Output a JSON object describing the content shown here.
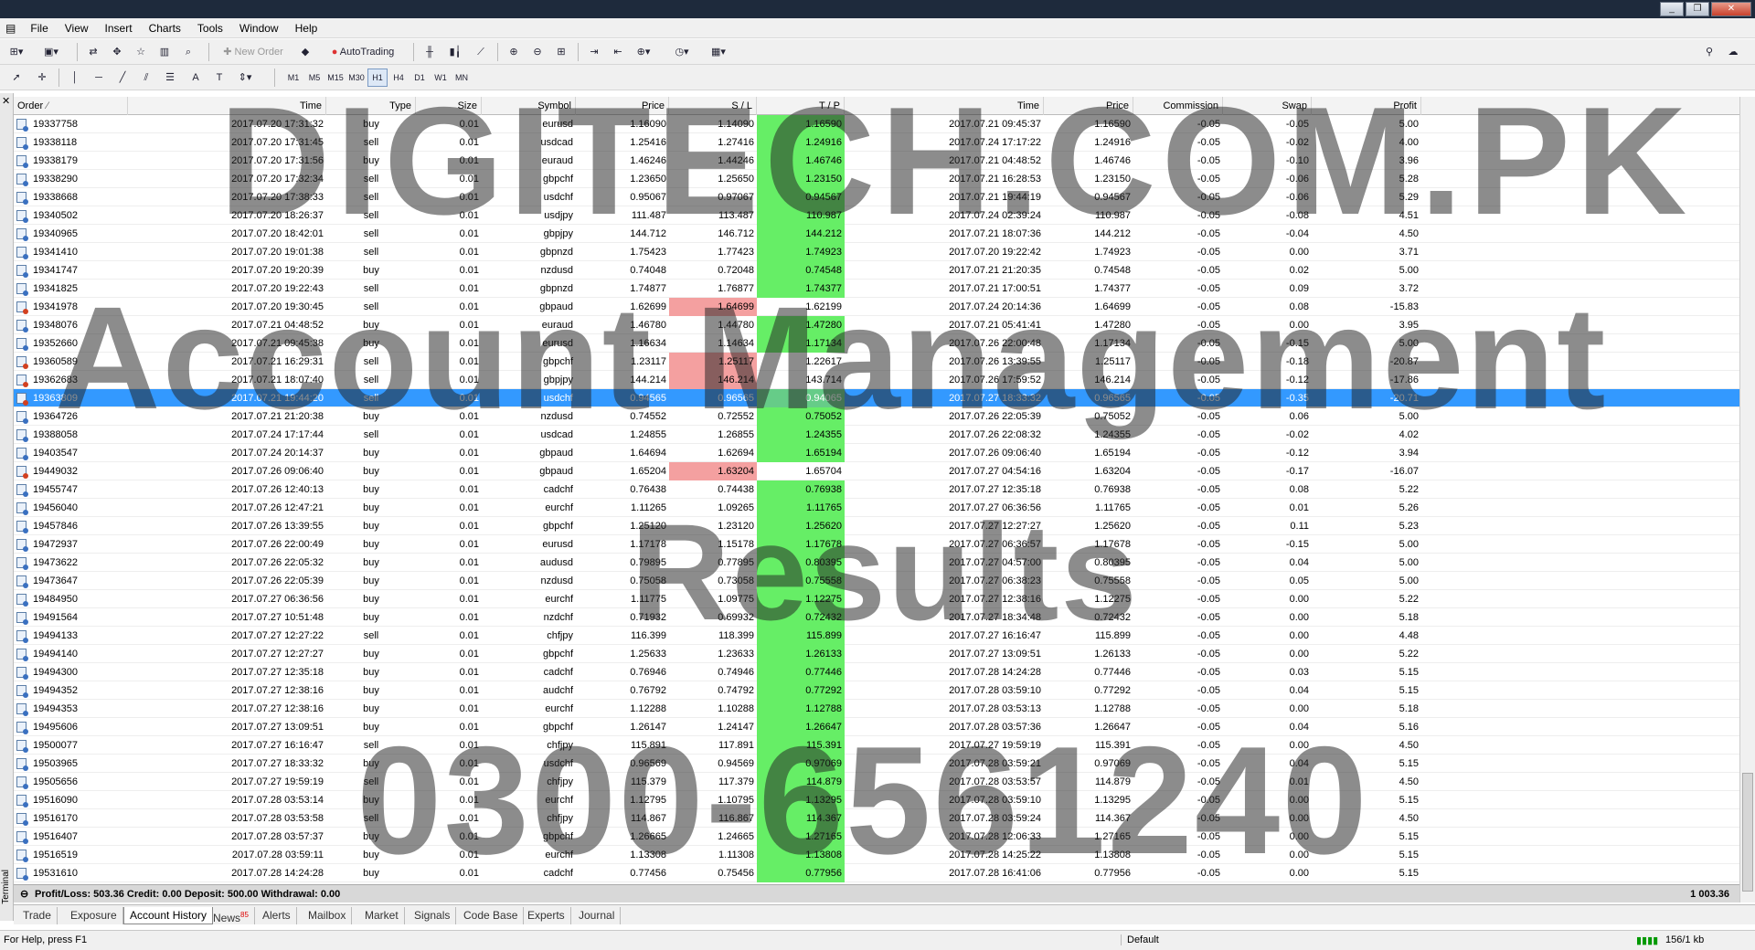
{
  "window": {
    "controls": [
      "_",
      "❐",
      "✕"
    ],
    "mdi_controls": [
      "_",
      "❐",
      "✕"
    ]
  },
  "menu": [
    "File",
    "View",
    "Insert",
    "Charts",
    "Tools",
    "Window",
    "Help"
  ],
  "toolbar": {
    "new_order": "New Order",
    "autotrading": "AutoTrading",
    "timeframes": [
      "M1",
      "M5",
      "M15",
      "M30",
      "H1",
      "H4",
      "D1",
      "W1",
      "MN"
    ],
    "active_timeframe": "H1"
  },
  "columns": [
    "Order",
    "Time",
    "Type",
    "Size",
    "Symbol",
    "Price",
    "S / L",
    "T / P",
    "Time",
    "Price",
    "Commission",
    "Swap",
    "Profit"
  ],
  "rows": [
    [
      "19337758",
      "2017.07.20 17:31:32",
      "buy",
      "0.01",
      "eurusd",
      "1.16090",
      "1.14090",
      "1.16590",
      "2017.07.21 09:45:37",
      "1.16590",
      "-0.05",
      "-0.05",
      "5.00"
    ],
    [
      "19338118",
      "2017.07.20 17:31:45",
      "sell",
      "0.01",
      "usdcad",
      "1.25416",
      "1.27416",
      "1.24916",
      "2017.07.24 17:17:22",
      "1.24916",
      "-0.05",
      "-0.02",
      "4.00"
    ],
    [
      "19338179",
      "2017.07.20 17:31:56",
      "buy",
      "0.01",
      "euraud",
      "1.46246",
      "1.44246",
      "1.46746",
      "2017.07.21 04:48:52",
      "1.46746",
      "-0.05",
      "-0.10",
      "3.96"
    ],
    [
      "19338290",
      "2017.07.20 17:32:34",
      "sell",
      "0.01",
      "gbpchf",
      "1.23650",
      "1.25650",
      "1.23150",
      "2017.07.21 16:28:53",
      "1.23150",
      "-0.05",
      "-0.06",
      "5.28"
    ],
    [
      "19338668",
      "2017.07.20 17:38:33",
      "sell",
      "0.01",
      "usdchf",
      "0.95067",
      "0.97067",
      "0.94567",
      "2017.07.21 19:44:19",
      "0.94567",
      "-0.05",
      "-0.06",
      "5.29"
    ],
    [
      "19340502",
      "2017.07.20 18:26:37",
      "sell",
      "0.01",
      "usdjpy",
      "111.487",
      "113.487",
      "110.987",
      "2017.07.24 02:39:24",
      "110.987",
      "-0.05",
      "-0.08",
      "4.51"
    ],
    [
      "19340965",
      "2017.07.20 18:42:01",
      "sell",
      "0.01",
      "gbpjpy",
      "144.712",
      "146.712",
      "144.212",
      "2017.07.21 18:07:36",
      "144.212",
      "-0.05",
      "-0.04",
      "4.50"
    ],
    [
      "19341410",
      "2017.07.20 19:01:38",
      "sell",
      "0.01",
      "gbpnzd",
      "1.75423",
      "1.77423",
      "1.74923",
      "2017.07.20 19:22:42",
      "1.74923",
      "-0.05",
      "0.00",
      "3.71"
    ],
    [
      "19341747",
      "2017.07.20 19:20:39",
      "buy",
      "0.01",
      "nzdusd",
      "0.74048",
      "0.72048",
      "0.74548",
      "2017.07.21 21:20:35",
      "0.74548",
      "-0.05",
      "0.02",
      "5.00"
    ],
    [
      "19341825",
      "2017.07.20 19:22:43",
      "sell",
      "0.01",
      "gbpnzd",
      "1.74877",
      "1.76877",
      "1.74377",
      "2017.07.21 17:00:51",
      "1.74377",
      "-0.05",
      "0.09",
      "3.72"
    ],
    [
      "19341978",
      "2017.07.20 19:30:45",
      "sell",
      "0.01",
      "gbpaud",
      "1.62699",
      "1.64699",
      "1.62199",
      "2017.07.24 20:14:36",
      "1.64699",
      "-0.05",
      "0.08",
      "-15.83"
    ],
    [
      "19348076",
      "2017.07.21 04:48:52",
      "buy",
      "0.01",
      "euraud",
      "1.46780",
      "1.44780",
      "1.47280",
      "2017.07.21 05:41:41",
      "1.47280",
      "-0.05",
      "0.00",
      "3.95"
    ],
    [
      "19352660",
      "2017.07.21 09:45:38",
      "buy",
      "0.01",
      "eurusd",
      "1.16634",
      "1.14634",
      "1.17134",
      "2017.07.26 22:00:48",
      "1.17134",
      "-0.05",
      "-0.15",
      "5.00"
    ],
    [
      "19360589",
      "2017.07.21 16:29:31",
      "sell",
      "0.01",
      "gbpchf",
      "1.23117",
      "1.25117",
      "1.22617",
      "2017.07.26 13:39:55",
      "1.25117",
      "-0.05",
      "-0.18",
      "-20.87"
    ],
    [
      "19362683",
      "2017.07.21 18:07:40",
      "sell",
      "0.01",
      "gbpjpy",
      "144.214",
      "146.214",
      "143.714",
      "2017.07.26 17:59:52",
      "146.214",
      "-0.05",
      "-0.12",
      "-17.86"
    ],
    [
      "19363809",
      "2017.07.21 19:44:20",
      "sell",
      "0.01",
      "usdchf",
      "0.94565",
      "0.96565",
      "0.94065",
      "2017.07.27 18:33:32",
      "0.96565",
      "-0.05",
      "-0.35",
      "-20.71"
    ],
    [
      "19364726",
      "2017.07.21 21:20:38",
      "buy",
      "0.01",
      "nzdusd",
      "0.74552",
      "0.72552",
      "0.75052",
      "2017.07.26 22:05:39",
      "0.75052",
      "-0.05",
      "0.06",
      "5.00"
    ],
    [
      "19388058",
      "2017.07.24 17:17:44",
      "sell",
      "0.01",
      "usdcad",
      "1.24855",
      "1.26855",
      "1.24355",
      "2017.07.26 22:08:32",
      "1.24355",
      "-0.05",
      "-0.02",
      "4.02"
    ],
    [
      "19403547",
      "2017.07.24 20:14:37",
      "buy",
      "0.01",
      "gbpaud",
      "1.64694",
      "1.62694",
      "1.65194",
      "2017.07.26 09:06:40",
      "1.65194",
      "-0.05",
      "-0.12",
      "3.94"
    ],
    [
      "19449032",
      "2017.07.26 09:06:40",
      "buy",
      "0.01",
      "gbpaud",
      "1.65204",
      "1.63204",
      "1.65704",
      "2017.07.27 04:54:16",
      "1.63204",
      "-0.05",
      "-0.17",
      "-16.07"
    ],
    [
      "19455747",
      "2017.07.26 12:40:13",
      "buy",
      "0.01",
      "cadchf",
      "0.76438",
      "0.74438",
      "0.76938",
      "2017.07.27 12:35:18",
      "0.76938",
      "-0.05",
      "0.08",
      "5.22"
    ],
    [
      "19456040",
      "2017.07.26 12:47:21",
      "buy",
      "0.01",
      "eurchf",
      "1.11265",
      "1.09265",
      "1.11765",
      "2017.07.27 06:36:56",
      "1.11765",
      "-0.05",
      "0.01",
      "5.26"
    ],
    [
      "19457846",
      "2017.07.26 13:39:55",
      "buy",
      "0.01",
      "gbpchf",
      "1.25120",
      "1.23120",
      "1.25620",
      "2017.07.27 12:27:27",
      "1.25620",
      "-0.05",
      "0.11",
      "5.23"
    ],
    [
      "19472937",
      "2017.07.26 22:00:49",
      "buy",
      "0.01",
      "eurusd",
      "1.17178",
      "1.15178",
      "1.17678",
      "2017.07.27 06:36:57",
      "1.17678",
      "-0.05",
      "-0.15",
      "5.00"
    ],
    [
      "19473622",
      "2017.07.26 22:05:32",
      "buy",
      "0.01",
      "audusd",
      "0.79895",
      "0.77895",
      "0.80395",
      "2017.07.27 04:57:00",
      "0.80395",
      "-0.05",
      "0.04",
      "5.00"
    ],
    [
      "19473647",
      "2017.07.26 22:05:39",
      "buy",
      "0.01",
      "nzdusd",
      "0.75058",
      "0.73058",
      "0.75558",
      "2017.07.27 06:38:23",
      "0.75558",
      "-0.05",
      "0.05",
      "5.00"
    ],
    [
      "19484950",
      "2017.07.27 06:36:56",
      "buy",
      "0.01",
      "eurchf",
      "1.11775",
      "1.09775",
      "1.12275",
      "2017.07.27 12:38:16",
      "1.12275",
      "-0.05",
      "0.00",
      "5.22"
    ],
    [
      "19491564",
      "2017.07.27 10:51:48",
      "buy",
      "0.01",
      "nzdchf",
      "0.71932",
      "0.69932",
      "0.72432",
      "2017.07.27 18:34:48",
      "0.72432",
      "-0.05",
      "0.00",
      "5.18"
    ],
    [
      "19494133",
      "2017.07.27 12:27:22",
      "sell",
      "0.01",
      "chfjpy",
      "116.399",
      "118.399",
      "115.899",
      "2017.07.27 16:16:47",
      "115.899",
      "-0.05",
      "0.00",
      "4.48"
    ],
    [
      "19494140",
      "2017.07.27 12:27:27",
      "buy",
      "0.01",
      "gbpchf",
      "1.25633",
      "1.23633",
      "1.26133",
      "2017.07.27 13:09:51",
      "1.26133",
      "-0.05",
      "0.00",
      "5.22"
    ],
    [
      "19494300",
      "2017.07.27 12:35:18",
      "buy",
      "0.01",
      "cadchf",
      "0.76946",
      "0.74946",
      "0.77446",
      "2017.07.28 14:24:28",
      "0.77446",
      "-0.05",
      "0.03",
      "5.15"
    ],
    [
      "19494352",
      "2017.07.27 12:38:16",
      "buy",
      "0.01",
      "audchf",
      "0.76792",
      "0.74792",
      "0.77292",
      "2017.07.28 03:59:10",
      "0.77292",
      "-0.05",
      "0.04",
      "5.15"
    ],
    [
      "19494353",
      "2017.07.27 12:38:16",
      "buy",
      "0.01",
      "eurchf",
      "1.12288",
      "1.10288",
      "1.12788",
      "2017.07.28 03:53:13",
      "1.12788",
      "-0.05",
      "0.00",
      "5.18"
    ],
    [
      "19495606",
      "2017.07.27 13:09:51",
      "buy",
      "0.01",
      "gbpchf",
      "1.26147",
      "1.24147",
      "1.26647",
      "2017.07.28 03:57:36",
      "1.26647",
      "-0.05",
      "0.04",
      "5.16"
    ],
    [
      "19500077",
      "2017.07.27 16:16:47",
      "sell",
      "0.01",
      "chfjpy",
      "115.891",
      "117.891",
      "115.391",
      "2017.07.27 19:59:19",
      "115.391",
      "-0.05",
      "0.00",
      "4.50"
    ],
    [
      "19503965",
      "2017.07.27 18:33:32",
      "buy",
      "0.01",
      "usdchf",
      "0.96569",
      "0.94569",
      "0.97069",
      "2017.07.28 03:59:21",
      "0.97069",
      "-0.05",
      "0.04",
      "5.15"
    ],
    [
      "19505656",
      "2017.07.27 19:59:19",
      "sell",
      "0.01",
      "chfjpy",
      "115.379",
      "117.379",
      "114.879",
      "2017.07.28 03:53:57",
      "114.879",
      "-0.05",
      "0.01",
      "4.50"
    ],
    [
      "19516090",
      "2017.07.28 03:53:14",
      "buy",
      "0.01",
      "eurchf",
      "1.12795",
      "1.10795",
      "1.13295",
      "2017.07.28 03:59:10",
      "1.13295",
      "-0.05",
      "0.00",
      "5.15"
    ],
    [
      "19516170",
      "2017.07.28 03:53:58",
      "sell",
      "0.01",
      "chfjpy",
      "114.867",
      "116.867",
      "114.367",
      "2017.07.28 03:59:24",
      "114.367",
      "-0.05",
      "0.00",
      "4.50"
    ],
    [
      "19516407",
      "2017.07.28 03:57:37",
      "buy",
      "0.01",
      "gbpchf",
      "1.26665",
      "1.24665",
      "1.27165",
      "2017.07.28 12:06:33",
      "1.27165",
      "-0.05",
      "0.00",
      "5.15"
    ],
    [
      "19516519",
      "2017.07.28 03:59:11",
      "buy",
      "0.01",
      "eurchf",
      "1.13308",
      "1.11308",
      "1.13808",
      "2017.07.28 14:25:22",
      "1.13808",
      "-0.05",
      "0.00",
      "5.15"
    ],
    [
      "19531610",
      "2017.07.28 14:24:28",
      "buy",
      "0.01",
      "cadchf",
      "0.77456",
      "0.75456",
      "0.77956",
      "2017.07.28 16:41:06",
      "0.77956",
      "-0.05",
      "0.00",
      "5.15"
    ]
  ],
  "selected_order": "19363809",
  "summary": {
    "text": "Profit/Loss: 503.36  Credit: 0.00  Deposit: 500.00  Withdrawal: 0.00",
    "total": "1 003.36"
  },
  "tabs": [
    {
      "label": "Trade"
    },
    {
      "label": "Exposure"
    },
    {
      "label": "Account History",
      "active": true
    },
    {
      "label": "News",
      "badge": "85"
    },
    {
      "label": "Alerts"
    },
    {
      "label": "Mailbox"
    },
    {
      "label": "Market"
    },
    {
      "label": "Signals"
    },
    {
      "label": "Code Base"
    },
    {
      "label": "Experts"
    },
    {
      "label": "Journal"
    }
  ],
  "side_label": "Terminal",
  "status": {
    "help": "For Help, press F1",
    "profile": "Default",
    "traffic": "156/1 kb"
  },
  "watermark": [
    "DIGITECH.COM.PK",
    "Account Management",
    "Results",
    "0300-6561240"
  ],
  "colors": {
    "selected_row": "#3399ff",
    "tp_hit": "#66ee66",
    "sl_hit": "#f4a0a0"
  }
}
